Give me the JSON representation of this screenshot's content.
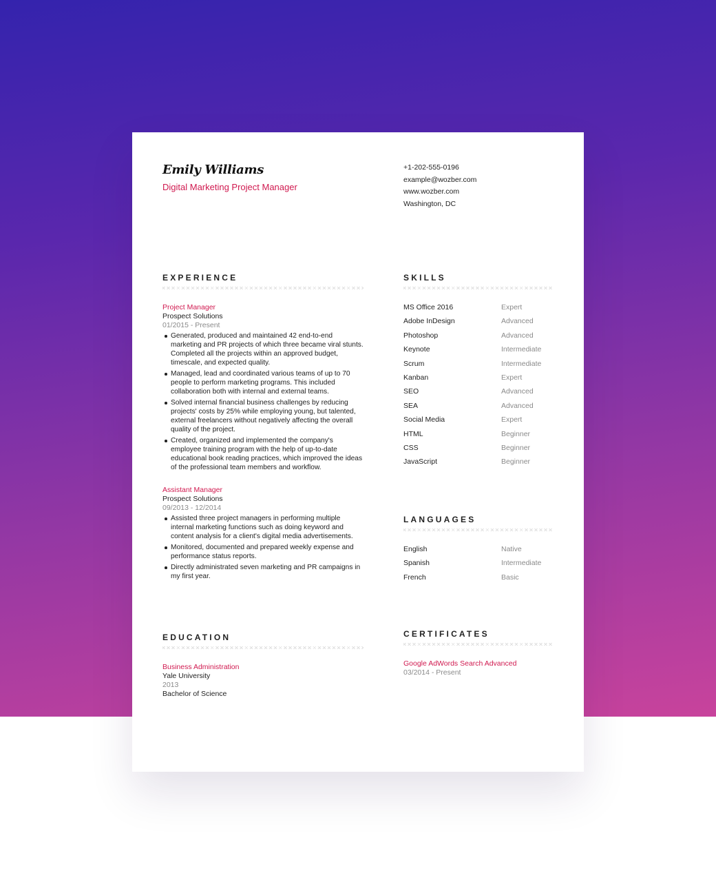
{
  "header": {
    "name": "Emily Williams",
    "role": "Digital Marketing Project Manager",
    "contact": {
      "phone": "+1-202-555-0196",
      "email": "example@wozber.com",
      "website": "www.wozber.com",
      "location": "Washington, DC"
    }
  },
  "experience": {
    "title": "EXPERIENCE",
    "jobs": [
      {
        "title": "Project Manager",
        "company": "Prospect Solutions",
        "dates": "01/2015 - Present",
        "bullets": [
          "Generated, produced and maintained 42 end-to-end marketing and PR projects of which three became viral stunts. Completed all the projects within an approved budget, timescale, and expected quality.",
          "Managed, lead and coordinated various teams of up to 70 people to perform marketing programs. This included collaboration both with internal and external teams.",
          "Solved internal financial business challenges by reducing projects' costs by 25% while employing young, but talented, external freelancers without negatively affecting the overall quality of the project.",
          "Created, organized and implemented the company's employee training program with the help of up-to-date educational book reading practices, which improved the ideas of the professional team members and workflow."
        ]
      },
      {
        "title": "Assistant Manager",
        "company": "Prospect Solutions",
        "dates": "09/2013 - 12/2014",
        "bullets": [
          "Assisted three project managers in performing multiple internal marketing functions such as doing keyword and content analysis for a client's digital media advertisements.",
          "Monitored, documented and prepared weekly expense and performance status reports.",
          "Directly administrated seven marketing and PR campaigns in my first year."
        ]
      }
    ]
  },
  "skills": {
    "title": "SKILLS",
    "items": [
      {
        "name": "MS Office 2016",
        "level": "Expert"
      },
      {
        "name": "Adobe InDesign",
        "level": "Advanced"
      },
      {
        "name": "Photoshop",
        "level": "Advanced"
      },
      {
        "name": "Keynote",
        "level": "Intermediate"
      },
      {
        "name": "Scrum",
        "level": "Intermediate"
      },
      {
        "name": "Kanban",
        "level": "Expert"
      },
      {
        "name": "SEO",
        "level": "Advanced"
      },
      {
        "name": "SEA",
        "level": "Advanced"
      },
      {
        "name": "Social Media",
        "level": "Expert"
      },
      {
        "name": "HTML",
        "level": "Beginner"
      },
      {
        "name": "CSS",
        "level": "Beginner"
      },
      {
        "name": "JavaScript",
        "level": "Beginner"
      }
    ]
  },
  "languages": {
    "title": "LANGUAGES",
    "items": [
      {
        "name": "English",
        "level": "Native"
      },
      {
        "name": "Spanish",
        "level": "Intermediate"
      },
      {
        "name": "French",
        "level": "Basic"
      }
    ]
  },
  "education": {
    "title": "EDUCATION",
    "degree": "Business Administration",
    "school": "Yale University",
    "year": "2013",
    "level": "Bachelor of Science"
  },
  "certificates": {
    "title": "CERTIFICATES",
    "name": "Google AdWords Search Advanced",
    "dates": "03/2014 - Present"
  },
  "colors": {
    "accent": "#d0194f",
    "gradient_start": "#3423ad",
    "gradient_end": "#c8439c"
  }
}
